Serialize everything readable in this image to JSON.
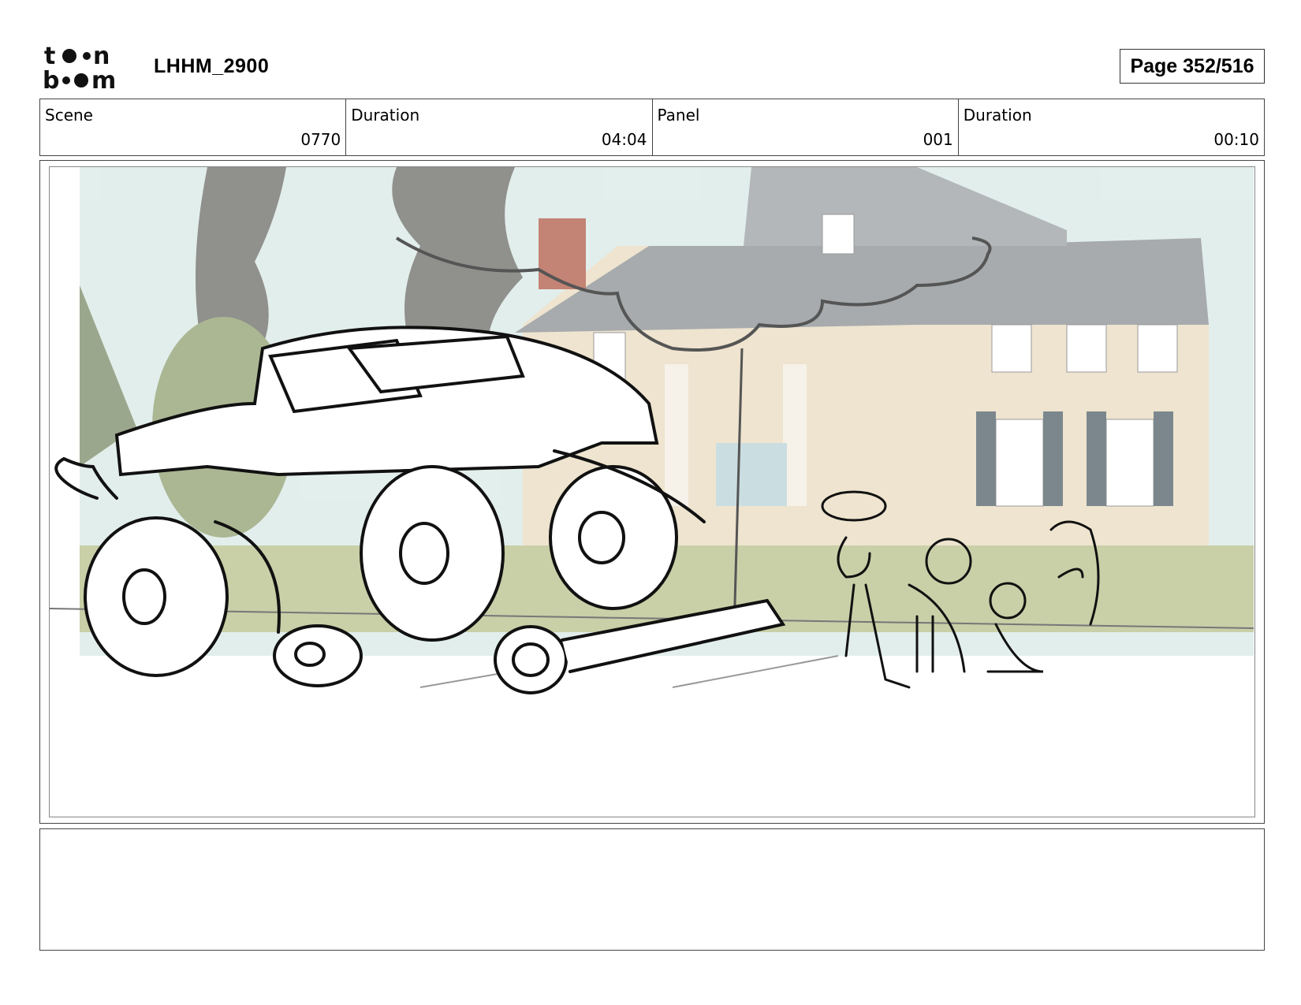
{
  "header": {
    "logo_text": [
      "to•n",
      "b••m"
    ],
    "project_title": "LHHM_2900",
    "page_label": "Page 352/516"
  },
  "info": {
    "scene_label": "Scene",
    "scene_value": "0770",
    "scene_duration_label": "Duration",
    "scene_duration_value": "04:04",
    "panel_label": "Panel",
    "panel_value": "001",
    "panel_duration_label": "Duration",
    "panel_duration_value": "00:10"
  },
  "notes": {
    "text": ""
  },
  "colors": {
    "sky": "#d9e9e6",
    "house": "#e9dcc0",
    "roof": "#8a8f92",
    "trees": "#6b6b66",
    "grass": "#b8c08a",
    "ink": "#111111"
  }
}
